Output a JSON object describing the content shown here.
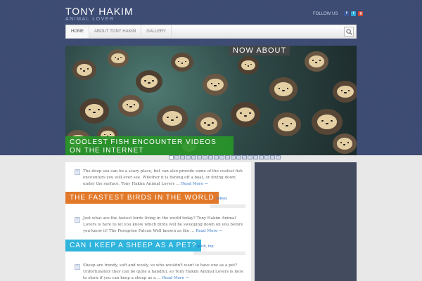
{
  "site": {
    "title": "TONY HAKIM",
    "tagline": "ANIMAL LOVER"
  },
  "follow": {
    "label": "FOLLOW US",
    "icons": [
      "facebook-icon",
      "twitter-icon",
      "google-plus-icon"
    ]
  },
  "nav": {
    "items": [
      {
        "label": "HOME",
        "active": true
      },
      {
        "label": "ABOUT TONY HAKIM",
        "active": false
      },
      {
        "label": "GALLERY",
        "active": false
      }
    ],
    "search_icon": "search-icon"
  },
  "slider": {
    "caption": "COOLEST FISH ENCOUNTER VIDEOS ON THE INTERNET",
    "next_caption": "NOW ABOUT",
    "dot_count": 20,
    "active_dot": 0
  },
  "posts": [
    {
      "excerpt": "The deep sea can be a scary place, but can also provide some of the coolest fish encounters you will ever see. Whether it is fishing off a boat, or diving down under the surface, Tony Hakim Animal Lovers …",
      "read_more": "Read More →"
    },
    {
      "title": "THE FASTEST BIRDS IN THE WORLD",
      "tags": "videos",
      "excerpt": "Just what are the fastest birds living in the world today? Tony Hakim Animal Lovers is here to let you know which birds will be swooping down on you before you know it! The Peregrine Falcon Well known as the …",
      "read_more": "Read More →"
    },
    {
      "title": "CAN I KEEP A SHEEP AS A PET?",
      "tags": "quick, top",
      "excerpt": "Sheep are trendy, soft and wooly, so who wouldn't want to have one as a pet? Unfortunately they can be quite a handful, so Tony Hakim Animal Lovers is here to show if you can keep a sheep as a …",
      "read_more": "Read More →"
    }
  ],
  "colors": {
    "background": "#3b4a72",
    "caption_green": "#289628",
    "title_orange": "#e2792a",
    "title_cyan": "#2fb4dc",
    "link_blue": "#3a78c7",
    "sidebar": "#434b5f"
  }
}
